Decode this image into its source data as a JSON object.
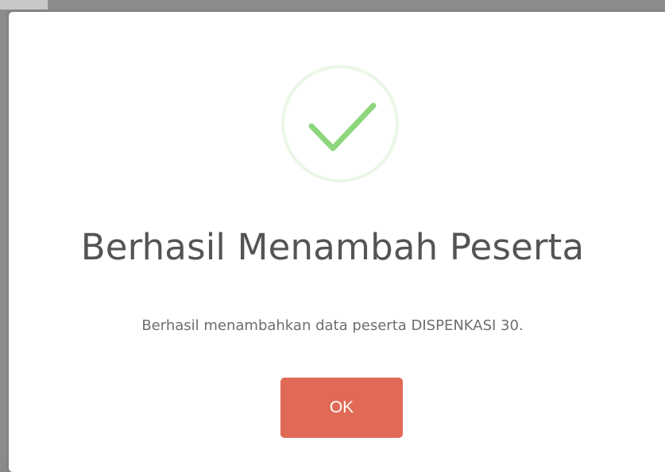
{
  "dialog": {
    "icon": "success-check-icon",
    "title": "Berhasil Menambah Peserta",
    "message": "Berhasil menambahkan data peserta DISPENKASI 30.",
    "ok_label": "OK"
  },
  "colors": {
    "confirm_button": "#e06a56",
    "success_check": "#8ed67c",
    "success_ring": "#eaf6e6"
  }
}
